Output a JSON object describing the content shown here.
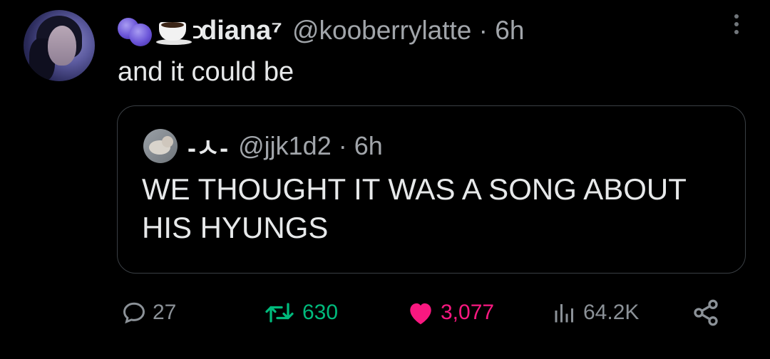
{
  "tweet": {
    "display_name": "diana⁷",
    "handle": "@kooberrylatte",
    "time": "· 6h",
    "text": "and it could be",
    "emojis": [
      "blueberries-icon",
      "hot-beverage-icon"
    ]
  },
  "quote": {
    "display_name": "-ㅅ-",
    "handle": "@jjk1d2",
    "time": "· 6h",
    "text": "WE THOUGHT IT WAS A SONG ABOUT HIS HYUNGS"
  },
  "actions": {
    "replies": "27",
    "retweets": "630",
    "likes": "3,077",
    "views": "64.2K"
  },
  "colors": {
    "background": "#000000",
    "text": "#e7e9ea",
    "secondary": "#8b9197",
    "retweet": "#00ba7c",
    "like": "#f91880"
  }
}
